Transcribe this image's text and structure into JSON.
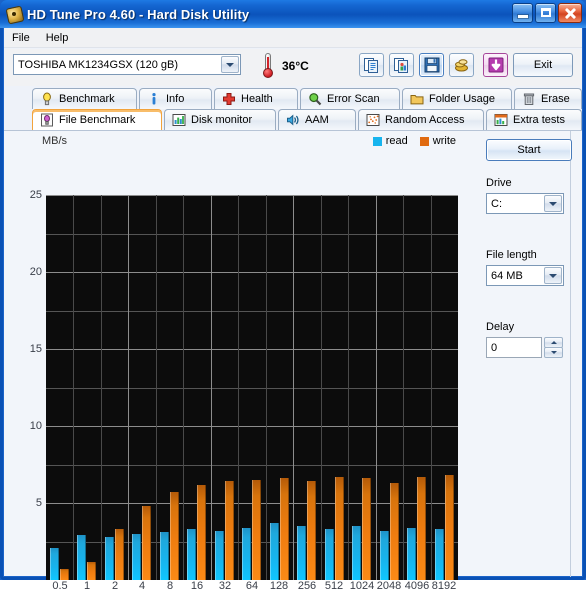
{
  "window": {
    "title": "HD Tune Pro 4.60 - Hard Disk Utility",
    "icon": "hard-disk-icon",
    "minimize_label": "",
    "maximize_label": "",
    "close_label": ""
  },
  "menu": {
    "items": [
      "File",
      "Help"
    ]
  },
  "toolbar": {
    "drive_selected": "TOSHIBA MK1234GSX (120 gB)",
    "temperature": "36°C",
    "thermometer_icon": "thermometer-icon",
    "buttons": [
      {
        "name": "copy-text-icon",
        "label": ""
      },
      {
        "name": "copy-image-icon",
        "label": ""
      },
      {
        "name": "save-icon",
        "label": ""
      },
      {
        "name": "gold-coins-icon",
        "label": ""
      },
      {
        "name": "download-arrow-icon",
        "label": ""
      }
    ],
    "exit_label": "Exit"
  },
  "tabs_row1": [
    {
      "label": "Benchmark",
      "icon": "lightbulb-icon",
      "active": false
    },
    {
      "label": "Info",
      "icon": "info-icon",
      "active": false
    },
    {
      "label": "Health",
      "icon": "red-cross-icon",
      "active": false
    },
    {
      "label": "Error Scan",
      "icon": "magnifier-icon",
      "active": false
    },
    {
      "label": "Folder Usage",
      "icon": "folder-icon",
      "active": false
    },
    {
      "label": "Erase",
      "icon": "trash-icon",
      "active": false
    }
  ],
  "tabs_row2": [
    {
      "label": "File Benchmark",
      "icon": "file-benchmark-icon",
      "active": true
    },
    {
      "label": "Disk monitor",
      "icon": "bar-chart-icon",
      "active": false
    },
    {
      "label": "AAM",
      "icon": "speaker-icon",
      "active": false
    },
    {
      "label": "Random Access",
      "icon": "scatter-icon",
      "active": false
    },
    {
      "label": "Extra tests",
      "icon": "extra-tests-icon",
      "active": false
    }
  ],
  "side_panel": {
    "start_label": "Start",
    "drive_label": "Drive",
    "drive_value": "C:",
    "file_length_label": "File length",
    "file_length_value": "64 MB",
    "delay_label": "Delay",
    "delay_value": "0"
  },
  "colors": {
    "read": "#17b4ee",
    "write": "#f07d10",
    "plot_background": "#0c0c0c",
    "grid": "#8d8d8d",
    "accent": "#f2a33c"
  },
  "chart_data": {
    "type": "bar",
    "title": "MB/s",
    "xlabel": "",
    "ylabel": "MB/s",
    "ylim": [
      0,
      25
    ],
    "yticks": [
      0,
      5,
      10,
      15,
      20,
      25
    ],
    "ytick_labels": [
      "",
      "5",
      "10",
      "15",
      "20",
      "25"
    ],
    "grid": true,
    "legend": [
      "read",
      "write"
    ],
    "legend_position": "top-right",
    "categories": [
      "0.5",
      "1",
      "2",
      "4",
      "8",
      "16",
      "32",
      "64",
      "128",
      "256",
      "512",
      "1024",
      "2048",
      "4096",
      "8192"
    ],
    "series": [
      {
        "name": "read",
        "color": "#17b4ee",
        "values": [
          2.1,
          2.9,
          2.8,
          3.0,
          3.1,
          3.3,
          3.2,
          3.4,
          3.7,
          3.5,
          3.3,
          3.5,
          3.2,
          3.4,
          3.3
        ]
      },
      {
        "name": "write",
        "color": "#f07d10",
        "values": [
          0.7,
          1.2,
          3.3,
          4.8,
          5.7,
          6.2,
          6.4,
          6.5,
          6.6,
          6.4,
          6.7,
          6.6,
          6.3,
          6.7,
          6.8
        ]
      }
    ]
  }
}
